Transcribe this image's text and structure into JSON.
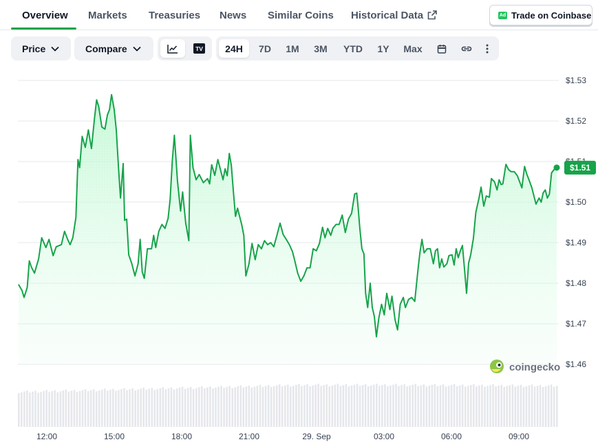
{
  "tabs": [
    {
      "label": "Overview",
      "active": true
    },
    {
      "label": "Markets"
    },
    {
      "label": "Treasuries"
    },
    {
      "label": "News"
    },
    {
      "label": "Similar Coins"
    },
    {
      "label": "Historical Data",
      "external_icon": "external-link-icon"
    }
  ],
  "ad_button": {
    "badge": "Ad",
    "label": "Trade on Coinbase"
  },
  "toolbar": {
    "price_dropdown": "Price",
    "compare_dropdown": "Compare",
    "chart_types": [
      {
        "icon": "line-chart-icon",
        "active": true
      },
      {
        "icon": "tradingview-icon"
      }
    ],
    "ranges": [
      "24H",
      "7D",
      "1M",
      "3M",
      "YTD",
      "1Y",
      "Max"
    ],
    "active_range": "24H",
    "tools": [
      "calendar-icon",
      "link-icon",
      "more-vertical-icon"
    ]
  },
  "watermark": "coingecko",
  "colors": {
    "line": "#16a34a",
    "fill_top": "#bbf7d0",
    "active_tab": "#16a34a"
  },
  "chart_data": {
    "type": "area",
    "title": "",
    "xlabel": "",
    "ylabel": "",
    "x_ticks": [
      "12:00",
      "15:00",
      "18:00",
      "21:00",
      "29. Sep",
      "03:00",
      "06:00",
      "09:00"
    ],
    "y_ticks": [
      "$1.53",
      "$1.52",
      "$1.51",
      "$1.50",
      "$1.49",
      "$1.48",
      "$1.47",
      "$1.46"
    ],
    "ylim": [
      1.46,
      1.53
    ],
    "xlim_hours": [
      10.3,
      34.6
    ],
    "current_price_label": "$1.51",
    "current_price": 1.5085,
    "grid": true,
    "series": [
      {
        "points": [
          [
            10.33,
            1.4797
          ],
          [
            10.5,
            1.4782
          ],
          [
            10.6,
            1.4765
          ],
          [
            10.75,
            1.479
          ],
          [
            10.85,
            1.4855
          ],
          [
            10.95,
            1.484
          ],
          [
            11.1,
            1.4825
          ],
          [
            11.3,
            1.486
          ],
          [
            11.45,
            1.4912
          ],
          [
            11.65,
            1.4888
          ],
          [
            11.8,
            1.4908
          ],
          [
            12.0,
            1.4868
          ],
          [
            12.15,
            1.489
          ],
          [
            12.4,
            1.4895
          ],
          [
            12.55,
            1.4928
          ],
          [
            12.7,
            1.4908
          ],
          [
            12.82,
            1.4895
          ],
          [
            12.95,
            1.4912
          ],
          [
            13.1,
            1.4962
          ],
          [
            13.2,
            1.5105
          ],
          [
            13.28,
            1.5085
          ],
          [
            13.4,
            1.5162
          ],
          [
            13.55,
            1.5135
          ],
          [
            13.7,
            1.5178
          ],
          [
            13.85,
            1.5132
          ],
          [
            14.0,
            1.5208
          ],
          [
            14.1,
            1.5252
          ],
          [
            14.2,
            1.5236
          ],
          [
            14.35,
            1.5185
          ],
          [
            14.5,
            1.518
          ],
          [
            14.62,
            1.5215
          ],
          [
            14.72,
            1.5228
          ],
          [
            14.82,
            1.5265
          ],
          [
            14.95,
            1.5228
          ],
          [
            15.05,
            1.5178
          ],
          [
            15.15,
            1.5088
          ],
          [
            15.25,
            1.501
          ],
          [
            15.38,
            1.5095
          ],
          [
            15.45,
            1.4955
          ],
          [
            15.55,
            1.4958
          ],
          [
            15.65,
            1.487
          ],
          [
            15.8,
            1.4848
          ],
          [
            15.95,
            1.4818
          ],
          [
            16.1,
            1.4848
          ],
          [
            16.2,
            1.4908
          ],
          [
            16.3,
            1.4828
          ],
          [
            16.4,
            1.4812
          ],
          [
            16.55,
            1.4885
          ],
          [
            16.75,
            1.4885
          ],
          [
            16.85,
            1.4918
          ],
          [
            16.95,
            1.4888
          ],
          [
            17.1,
            1.4928
          ],
          [
            17.25,
            1.4945
          ],
          [
            17.4,
            1.4935
          ],
          [
            17.55,
            1.496
          ],
          [
            17.65,
            1.5008
          ],
          [
            17.75,
            1.5102
          ],
          [
            17.85,
            1.5165
          ],
          [
            18.0,
            1.5052
          ],
          [
            18.15,
            1.4978
          ],
          [
            18.25,
            1.5025
          ],
          [
            18.4,
            1.4948
          ],
          [
            18.55,
            1.4905
          ],
          [
            18.62,
            1.5165
          ],
          [
            18.75,
            1.5085
          ],
          [
            18.9,
            1.5055
          ],
          [
            19.05,
            1.5068
          ],
          [
            19.25,
            1.5048
          ],
          [
            19.45,
            1.5058
          ],
          [
            19.55,
            1.5045
          ],
          [
            19.65,
            1.5092
          ],
          [
            19.8,
            1.5066
          ],
          [
            19.95,
            1.5105
          ],
          [
            20.1,
            1.5075
          ],
          [
            20.2,
            1.5055
          ],
          [
            20.3,
            1.5082
          ],
          [
            20.4,
            1.5065
          ],
          [
            20.5,
            1.512
          ],
          [
            20.6,
            1.509
          ],
          [
            20.7,
            1.5025
          ],
          [
            20.8,
            1.4965
          ],
          [
            20.9,
            1.4985
          ],
          [
            21.0,
            1.4965
          ],
          [
            21.1,
            1.4945
          ],
          [
            21.2,
            1.4918
          ],
          [
            21.3,
            1.4818
          ],
          [
            21.45,
            1.4848
          ],
          [
            21.6,
            1.4898
          ],
          [
            21.75,
            1.4858
          ],
          [
            21.9,
            1.4895
          ],
          [
            22.05,
            1.4885
          ],
          [
            22.2,
            1.4905
          ],
          [
            22.35,
            1.4895
          ],
          [
            22.5,
            1.49
          ],
          [
            22.65,
            1.489
          ],
          [
            22.8,
            1.4918
          ],
          [
            22.95,
            1.4948
          ],
          [
            23.1,
            1.492
          ],
          [
            23.25,
            1.4908
          ],
          [
            23.4,
            1.4895
          ],
          [
            23.55,
            1.4878
          ],
          [
            23.65,
            1.4858
          ],
          [
            23.8,
            1.4825
          ],
          [
            23.95,
            1.4805
          ],
          [
            24.1,
            1.4818
          ],
          [
            24.25,
            1.4838
          ],
          [
            24.4,
            1.4838
          ],
          [
            24.55,
            1.4885
          ],
          [
            24.7,
            1.488
          ],
          [
            24.85,
            1.4898
          ],
          [
            25.0,
            1.4938
          ],
          [
            25.12,
            1.4912
          ],
          [
            25.25,
            1.4935
          ],
          [
            25.4,
            1.4918
          ],
          [
            25.5,
            1.4935
          ],
          [
            25.65,
            1.4945
          ],
          [
            25.8,
            1.4945
          ],
          [
            25.95,
            1.4968
          ],
          [
            26.1,
            1.4925
          ],
          [
            26.25,
            1.4958
          ],
          [
            26.4,
            1.4972
          ],
          [
            26.55,
            1.502
          ],
          [
            26.65,
            1.5022
          ],
          [
            26.72,
            1.4985
          ],
          [
            26.8,
            1.4935
          ],
          [
            26.9,
            1.4885
          ],
          [
            27.0,
            1.4872
          ],
          [
            27.08,
            1.4775
          ],
          [
            27.18,
            1.474
          ],
          [
            27.3,
            1.48
          ],
          [
            27.4,
            1.474
          ],
          [
            27.5,
            1.4718
          ],
          [
            27.6,
            1.4668
          ],
          [
            27.72,
            1.4715
          ],
          [
            27.85,
            1.4748
          ],
          [
            27.98,
            1.4722
          ],
          [
            28.1,
            1.4775
          ],
          [
            28.25,
            1.4735
          ],
          [
            28.35,
            1.4768
          ],
          [
            28.5,
            1.471
          ],
          [
            28.62,
            1.4685
          ],
          [
            28.75,
            1.4748
          ],
          [
            28.9,
            1.4765
          ],
          [
            29.0,
            1.474
          ],
          [
            29.15,
            1.476
          ],
          [
            29.3,
            1.4765
          ],
          [
            29.45,
            1.4755
          ],
          [
            29.6,
            1.483
          ],
          [
            29.7,
            1.4875
          ],
          [
            29.8,
            1.4908
          ],
          [
            29.9,
            1.4875
          ],
          [
            30.05,
            1.4885
          ],
          [
            30.2,
            1.4885
          ],
          [
            30.35,
            1.4848
          ],
          [
            30.45,
            1.488
          ],
          [
            30.55,
            1.4885
          ],
          [
            30.65,
            1.4838
          ],
          [
            30.75,
            1.486
          ],
          [
            30.85,
            1.484
          ],
          [
            31.0,
            1.4848
          ],
          [
            31.1,
            1.4868
          ],
          [
            31.25,
            1.487
          ],
          [
            31.35,
            1.4845
          ],
          [
            31.45,
            1.4885
          ],
          [
            31.55,
            1.4863
          ],
          [
            31.65,
            1.488
          ],
          [
            31.75,
            1.4893
          ],
          [
            31.85,
            1.4835
          ],
          [
            31.95,
            1.4775
          ],
          [
            32.05,
            1.485
          ],
          [
            32.15,
            1.487
          ],
          [
            32.28,
            1.491
          ],
          [
            32.4,
            1.4975
          ],
          [
            32.55,
            1.501
          ],
          [
            32.65,
            1.5037
          ],
          [
            32.78,
            1.499
          ],
          [
            32.9,
            1.5015
          ],
          [
            33.05,
            1.5012
          ],
          [
            33.15,
            1.5058
          ],
          [
            33.3,
            1.505
          ],
          [
            33.42,
            1.503
          ],
          [
            33.52,
            1.5055
          ],
          [
            33.62,
            1.5043
          ],
          [
            33.7,
            1.5045
          ],
          [
            33.85,
            1.5093
          ],
          [
            33.98,
            1.508
          ],
          [
            34.1,
            1.5075
          ],
          [
            34.25,
            1.5075
          ],
          [
            34.4,
            1.5065
          ],
          [
            34.55,
            1.5045
          ],
          [
            34.62,
            1.5035
          ],
          [
            34.75,
            1.5088
          ],
          [
            34.85,
            1.507
          ],
          [
            35.0,
            1.505
          ],
          [
            35.1,
            1.5035
          ],
          [
            35.2,
            1.5015
          ],
          [
            35.3,
            1.4995
          ],
          [
            35.45,
            1.501
          ],
          [
            35.55,
            1.5
          ],
          [
            35.65,
            1.5023
          ],
          [
            35.75,
            1.503
          ],
          [
            35.85,
            1.501
          ],
          [
            35.95,
            1.502
          ],
          [
            36.05,
            1.5072
          ],
          [
            36.2,
            1.5082
          ],
          [
            36.3,
            1.5085
          ]
        ]
      }
    ],
    "volume_bars": {
      "count": 195,
      "relative": "low near start, rising toward midday, flat later"
    }
  }
}
